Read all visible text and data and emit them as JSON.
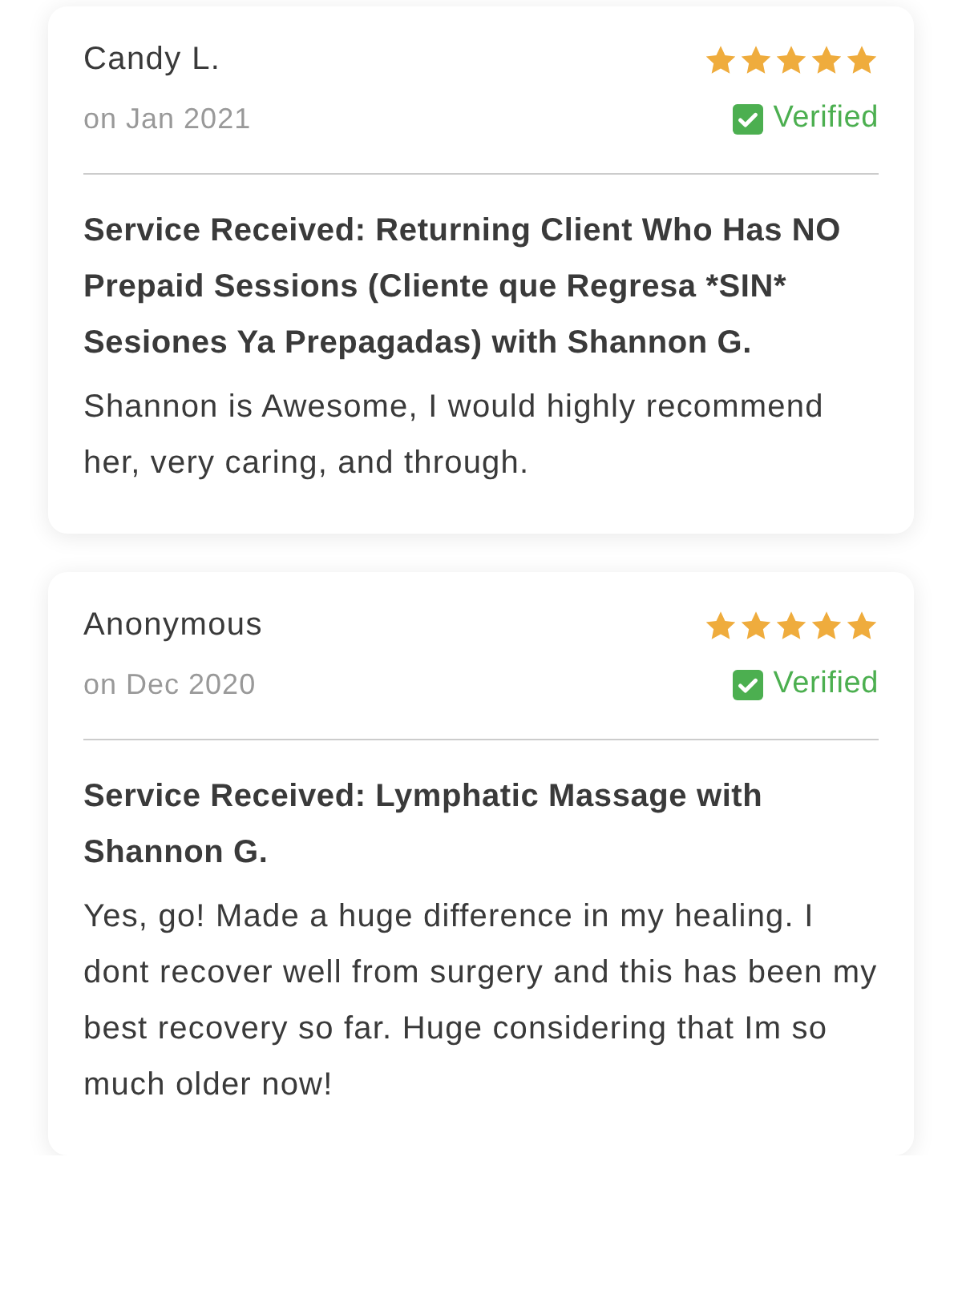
{
  "reviews": [
    {
      "author": "Candy L.",
      "stars": 5,
      "date": "on Jan 2021",
      "verified": true,
      "verified_label": "Verified",
      "service": "Service Received: Returning Client Who Has NO Prepaid Sessions (Cliente que Regresa *SIN* Sesiones Ya Prepagadas) with Shannon G.",
      "text": "Shannon is Awesome, I would highly recommend her, very caring, and through."
    },
    {
      "author": "Anonymous",
      "stars": 5,
      "date": "on Dec 2020",
      "verified": true,
      "verified_label": "Verified",
      "service": "Service Received: Lymphatic Massage with Shannon G.",
      "text": "Yes, go! Made a huge difference in my healing. I dont recover well from surgery and this has been my best recovery so far. Huge considering that Im so much older now!"
    }
  ]
}
